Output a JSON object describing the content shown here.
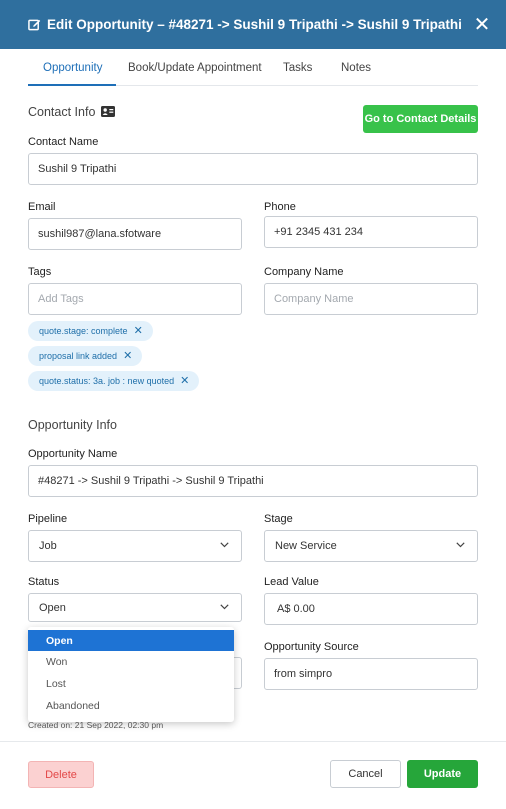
{
  "header": {
    "title": "Edit Opportunity – #48271 -> Sushil 9 Tripathi -> Sushil 9 Tripathi",
    "close_symbol": "✕",
    "bg_color": "#2f6f9e"
  },
  "tabs": [
    "Opportunity",
    "Book/Update Appointment",
    "Tasks",
    "Notes"
  ],
  "active_tab": "Opportunity",
  "contact_info": {
    "title": "Contact Info",
    "go_button": "Go to Contact Details",
    "contact_name": {
      "label": "Contact Name",
      "value": "Sushil 9 Tripathi"
    },
    "email": {
      "label": "Email",
      "value": "sushil987@lana.sfotware"
    },
    "phone": {
      "label": "Phone",
      "value": "+91 2345 431 234"
    },
    "tags": {
      "label": "Tags",
      "placeholder": "Add Tags"
    },
    "company": {
      "label": "Company Name",
      "placeholder": "Company Name"
    },
    "tag_chips": [
      "quote.stage: complete",
      "proposal link added",
      "quote.status: 3a. job : new quoted"
    ],
    "chip_remove": "✕"
  },
  "opportunity_info": {
    "title": "Opportunity Info",
    "name": {
      "label": "Opportunity Name",
      "value": "#48271 -> Sushil 9 Tripathi -> Sushil 9 Tripathi"
    },
    "pipeline": {
      "label": "Pipeline",
      "value": "Job"
    },
    "stage": {
      "label": "Stage",
      "value": "New Service"
    },
    "status": {
      "label": "Status",
      "value": "Open"
    },
    "lead_value": {
      "label": "Lead Value",
      "value": "A$ 0.00"
    },
    "source": {
      "label": "Opportunity Source",
      "value": "from simpro"
    },
    "created_on": "Created on: 21 Sep 2022, 02:30 pm"
  },
  "status_dropdown": {
    "options": [
      "Open",
      "Won",
      "Lost",
      "Abandoned"
    ],
    "selected": "Open"
  },
  "footer": {
    "delete": "Delete",
    "cancel": "Cancel",
    "update": "Update"
  }
}
